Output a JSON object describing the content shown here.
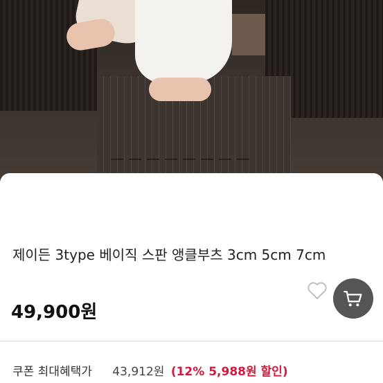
{
  "product": {
    "title": "제이든 3type 베이직 스판 앵클부츠 3cm 5cm 7cm",
    "price": "49,900원"
  },
  "coupon": {
    "label": "쿠폰 최대혜택가",
    "price": "43,912원",
    "discount": "(12% 5,988원 할인)"
  },
  "colors": {
    "accent": "#d6163c",
    "cart_button": "#555555"
  },
  "icons": {
    "wishlist": "heart-outline",
    "cart": "shopping-cart"
  }
}
